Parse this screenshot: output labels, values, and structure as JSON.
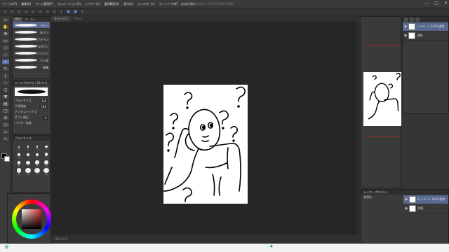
{
  "window": {
    "title": "■無題-■ (60.0%) - CLIP STUDIO PAINT"
  },
  "menu": [
    "ファイル(F)",
    "編集(E)",
    "ページ管理(P)",
    "アニメーション(A)",
    "レイヤー(L)",
    "選択範囲(S)",
    "表示(V)",
    "フィルター(I)",
    "ウィンドウ(W)",
    "ヘルプ(H)"
  ],
  "window_controls": {
    "minimize": "—",
    "maximize": "□",
    "close": "✕"
  },
  "toolbox": {
    "icons": [
      "zoom-icon",
      "hand-icon",
      "move-icon",
      "selection-icon",
      "lasso-icon",
      "eyedropper-icon",
      "pen-icon",
      "pencil-icon",
      "brush-icon",
      "airbrush-icon",
      "eraser-icon",
      "fill-icon",
      "gradient-icon",
      "shape-icon",
      "text-icon",
      "balloon-icon",
      "ruler-icon",
      "correct-line-icon"
    ]
  },
  "subtool": {
    "tabs": [
      "ペン",
      "マーカー"
    ],
    "brushes": [
      {
        "label": "Gペン"
      },
      {
        "label": "丸ペン"
      },
      {
        "label": "カブラペン"
      },
      {
        "label": "リアルGペン"
      },
      {
        "label": "ミリペン"
      },
      {
        "label": "ペン先"
      },
      {
        "label": "装飾"
      }
    ]
  },
  "tool_property": {
    "header": "ツールプロパティ[Gペン]",
    "rows": [
      {
        "label": "ブラシサイズ",
        "value": "8.0"
      },
      {
        "label": "不透明度",
        "value": "100"
      },
      {
        "label": "アンチエイリアス",
        "value": ""
      },
      {
        "label": "手ブレ補正",
        "value": "4"
      },
      {
        "label": "ベクター吸着",
        "value": ""
      }
    ]
  },
  "brush_size": {
    "header": "ブラシサイズ",
    "sizes": [
      "0.7",
      "1",
      "1.5",
      "2",
      "2.5",
      "3",
      "4",
      "5",
      "6",
      "7",
      "8",
      "10",
      "12",
      "15",
      "17",
      "20",
      "25",
      "30",
      "40",
      "50"
    ]
  },
  "document": {
    "tabs": [
      "キャンバス",
      "ページ"
    ],
    "status": "60.0   0.0"
  },
  "layers": {
    "top": [
      {
        "name": "レイヤー1 100%通常",
        "selected": true
      },
      {
        "name": "用紙",
        "selected": false
      }
    ],
    "bottom": {
      "header": "レイヤープロパティ",
      "rows": [
        {
          "name": "レイヤー1 100%通常",
          "selected": true
        },
        {
          "name": "用紙",
          "selected": false
        }
      ],
      "expression_label": "表現色",
      "expression_value": "カラー"
    }
  },
  "colors": {
    "accent": "#58688f",
    "panel": "#3c3c3c",
    "canvas_bg": "#262626",
    "paper": "#ffffff",
    "foreground": "#000000",
    "background": "#ffffff"
  },
  "taskbar": {
    "start_icon": "star-icon",
    "app_icon": "clip-studio-icon"
  }
}
